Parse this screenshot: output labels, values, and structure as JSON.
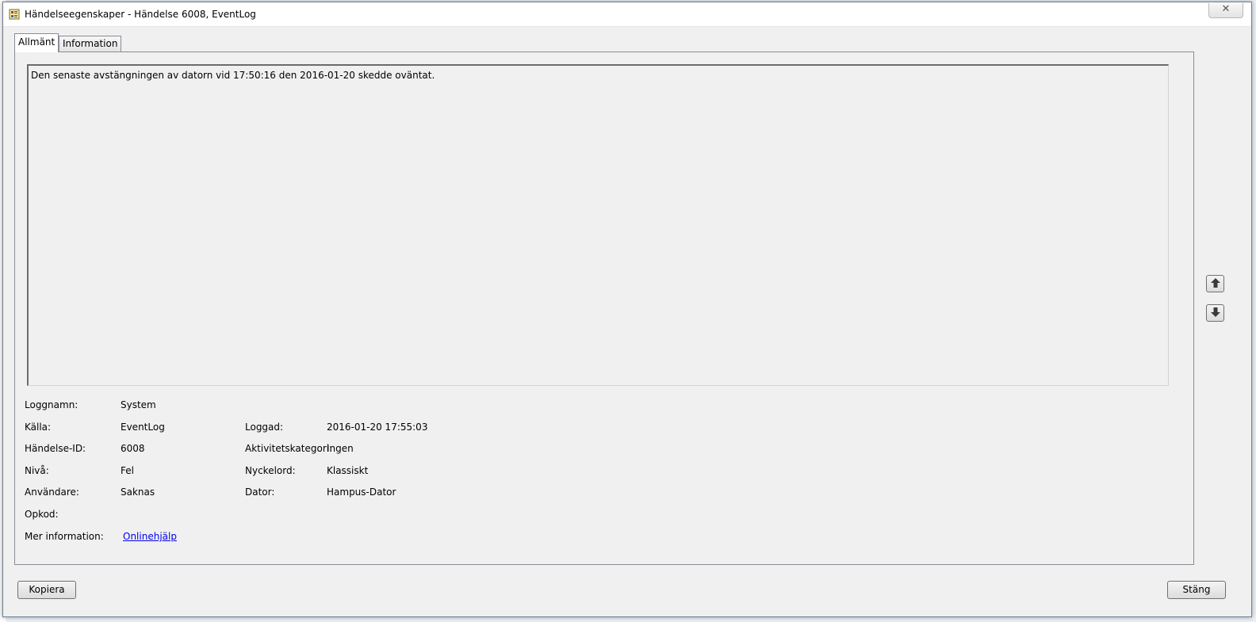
{
  "window": {
    "title": "Händelseegenskaper - Händelse 6008, EventLog",
    "close_glyph": "✕"
  },
  "tabs": [
    {
      "label": "Allmänt",
      "active": true
    },
    {
      "label": "Information",
      "active": false
    }
  ],
  "description": "Den senaste avstängningen av datorn vid 17:50:16 den 2016-01-20 skedde oväntat.",
  "fields": {
    "log_name": {
      "label": "Loggnamn:",
      "value": "System"
    },
    "source": {
      "label": "Källa:",
      "value": "EventLog"
    },
    "logged": {
      "label": "Loggad:",
      "value": "2016-01-20 17:55:03"
    },
    "event_id": {
      "label": "Händelse-ID:",
      "value": "6008"
    },
    "task_category": {
      "label": "Aktivitetskategori:",
      "value": "Ingen"
    },
    "level": {
      "label": "Nivå:",
      "value": "Fel"
    },
    "keywords": {
      "label": "Nyckelord:",
      "value": "Klassiskt"
    },
    "user": {
      "label": "Användare:",
      "value": "Saknas"
    },
    "computer": {
      "label": "Dator:",
      "value": "Hampus-Dator"
    },
    "opcode": {
      "label": "Opkod:",
      "value": ""
    },
    "more_info": {
      "label": "Mer information:",
      "link": "Onlinehjälp"
    }
  },
  "buttons": {
    "copy": "Kopiera",
    "close": "Stäng"
  },
  "icons": {
    "window_icon": "event-viewer-icon",
    "prev": "arrow-up-icon",
    "next": "arrow-down-icon"
  }
}
